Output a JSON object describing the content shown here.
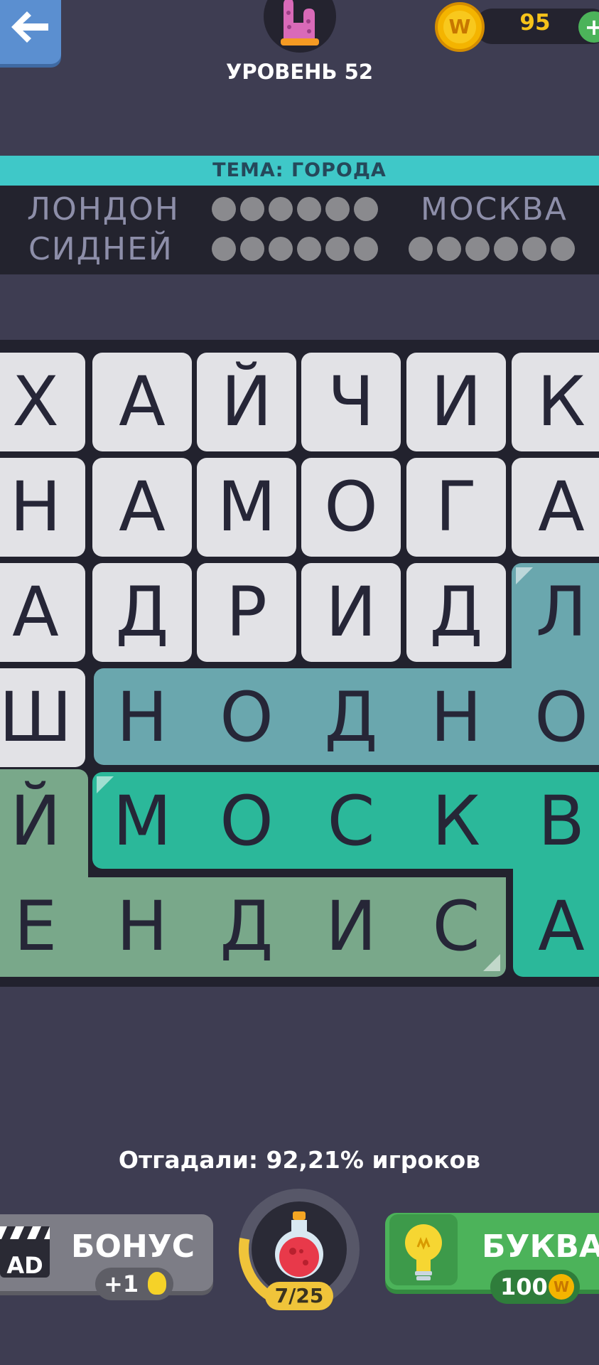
{
  "header": {
    "level_title": "УРОВЕНЬ 52",
    "coins": "95",
    "coin_symbol": "W",
    "plus": "+"
  },
  "theme": {
    "label": "ТЕМА: ГОРОДА",
    "words": [
      {
        "text": "ЛОНДОН",
        "found": true
      },
      {
        "text": "МОСКВА",
        "found": true
      },
      {
        "text": "СИДНЕЙ",
        "found": true
      }
    ],
    "hidden_words_letter_counts": [
      6,
      6
    ]
  },
  "grid": {
    "rows": [
      [
        "Х",
        "А",
        "Й",
        "Ч",
        "И",
        "К"
      ],
      [
        "Н",
        "А",
        "М",
        "О",
        "Г",
        "А"
      ],
      [
        "А",
        "Д",
        "Р",
        "И",
        "Д",
        "Л"
      ],
      [
        "Ш",
        "Н",
        "О",
        "Д",
        "Н",
        "О"
      ],
      [
        "Й",
        "М",
        "О",
        "С",
        "К",
        "В"
      ],
      [
        "Е",
        "Н",
        "Д",
        "И",
        "С",
        "А"
      ]
    ],
    "found_colors": {
      "london": "#6aa7ae",
      "moscow": "#2bb89a",
      "sydney": "#79a88a"
    }
  },
  "footer": {
    "solved_text": "Отгадали: 92,21% игроков",
    "bonus_label": "БОНУС",
    "bonus_reward": "+1",
    "ad_text": "AD",
    "potion_count": "7/25",
    "potion_progress": 0.28,
    "letter_label": "БУКВА",
    "letter_cost": "100"
  }
}
